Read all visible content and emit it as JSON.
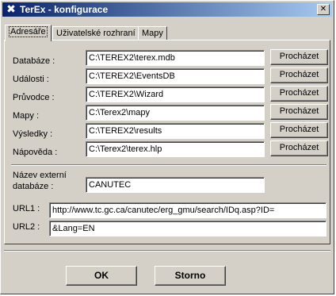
{
  "window": {
    "title": "TerEx - konfigurace"
  },
  "tabs": [
    {
      "label": "Adresáře",
      "active": true
    },
    {
      "label": "Uživatelské rozhraní",
      "active": false
    },
    {
      "label": "Mapy",
      "active": false
    }
  ],
  "paths": [
    {
      "label": "Databáze :",
      "value": "C:\\TEREX2\\terex.mdb",
      "button": "Procházet"
    },
    {
      "label": "Události :",
      "value": "C:\\TEREX2\\EventsDB",
      "button": "Procházet"
    },
    {
      "label": "Průvodce :",
      "value": "C:\\TEREX2\\Wizard",
      "button": "Procházet"
    },
    {
      "label": "Mapy :",
      "value": "C:\\Terex2\\mapy",
      "button": "Procházet"
    },
    {
      "label": "Výsledky :",
      "value": "C:\\TEREX2\\results",
      "button": "Procházet"
    },
    {
      "label": "Nápověda :",
      "value": "C:\\Terex2\\terex.hlp",
      "button": "Procházet"
    }
  ],
  "external_db": {
    "label_line1": "Název externí",
    "label_line2": "databáze :",
    "value": "CANUTEC"
  },
  "url1": {
    "label": "URL1 :",
    "value": "http://www.tc.gc.ca/canutec/erg_gmu/search/IDq.asp?ID="
  },
  "url2": {
    "label": "URL2 :",
    "value": "&Lang=EN"
  },
  "buttons": {
    "ok": "OK",
    "cancel": "Storno"
  }
}
